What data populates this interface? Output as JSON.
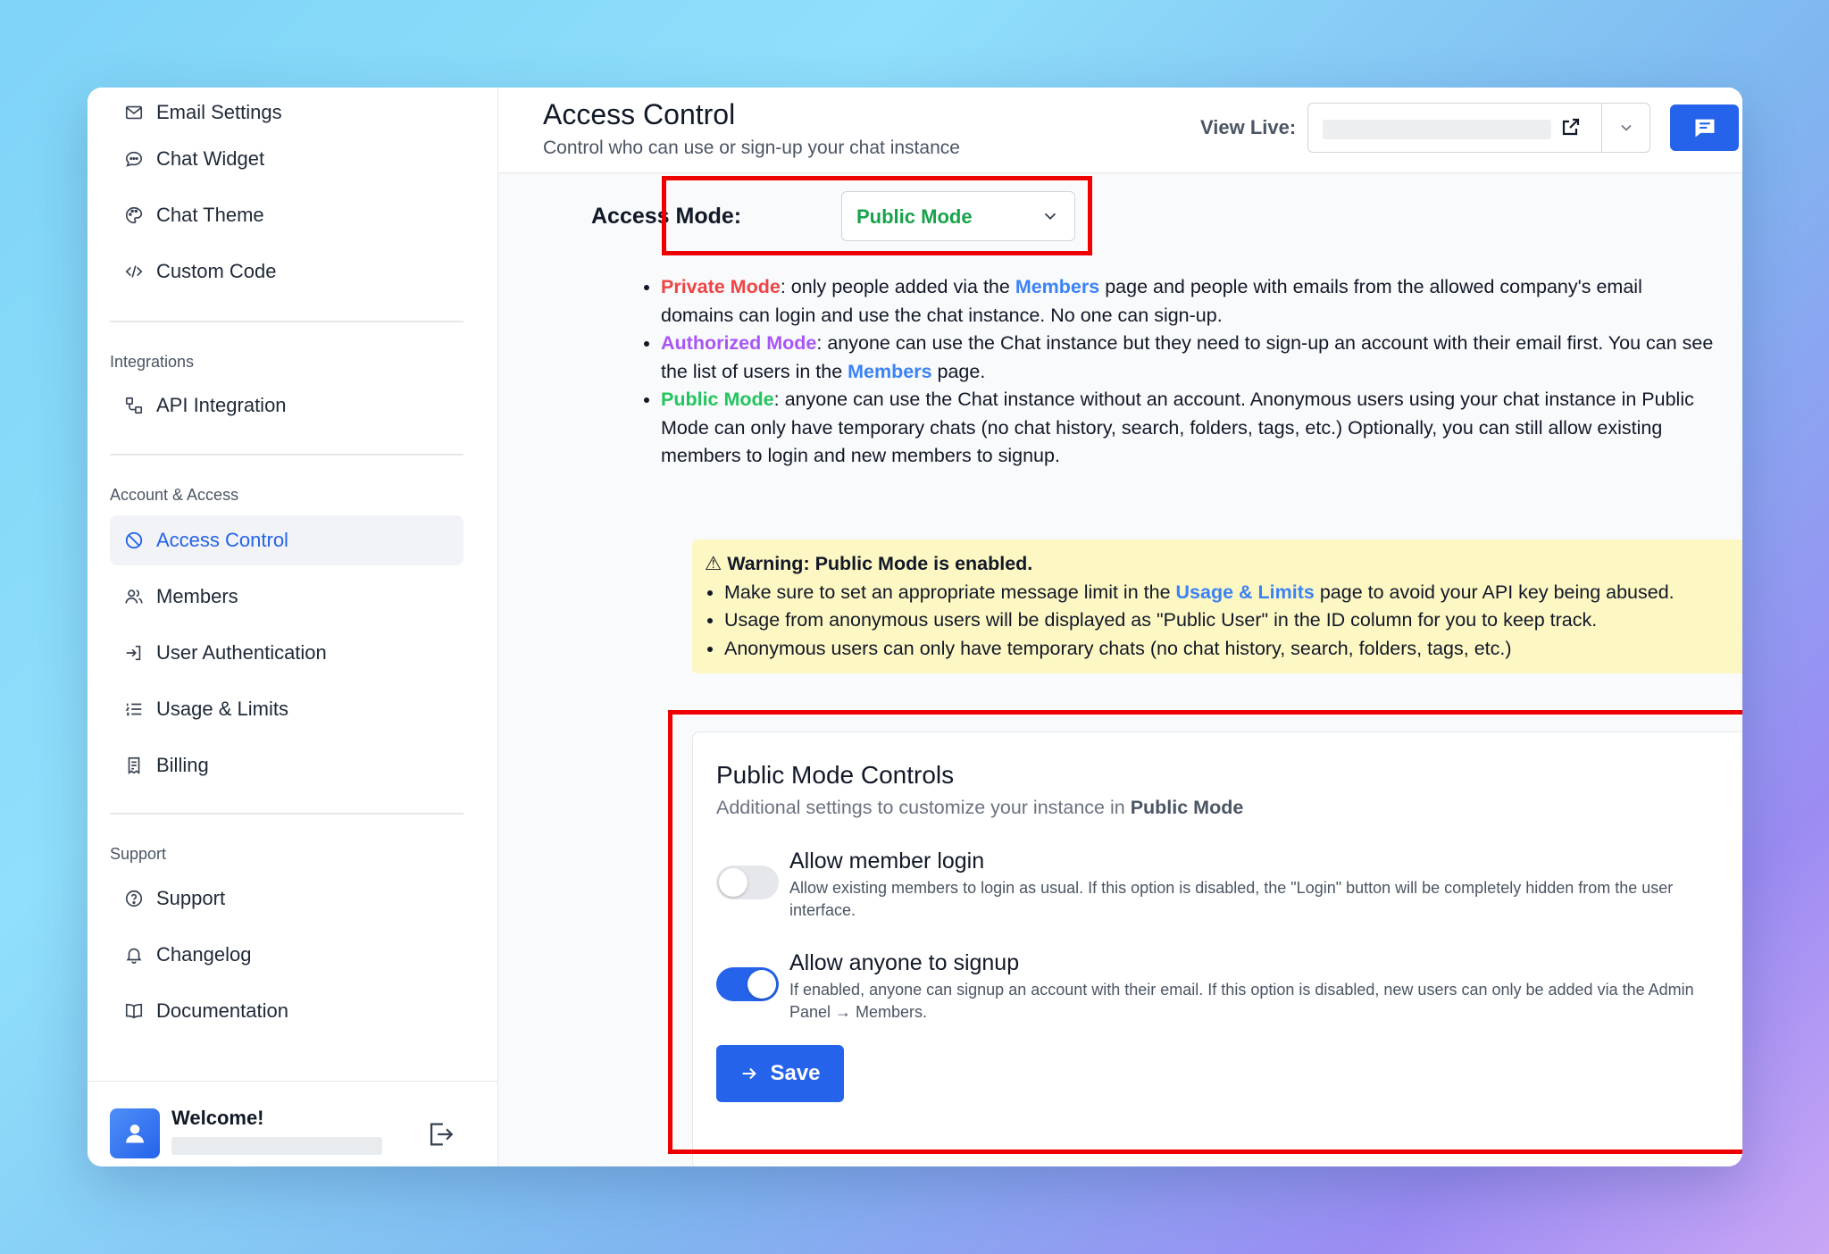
{
  "sidebar": {
    "top_items": [
      {
        "label": "Email Settings",
        "icon": "mail-icon"
      },
      {
        "label": "Chat Widget",
        "icon": "chat-bubble-icon"
      },
      {
        "label": "Chat Theme",
        "icon": "palette-icon"
      },
      {
        "label": "Custom Code",
        "icon": "code-icon"
      }
    ],
    "integrations": {
      "label": "Integrations",
      "items": [
        {
          "label": "API Integration",
          "icon": "api-icon"
        }
      ]
    },
    "account": {
      "label": "Account & Access",
      "items": [
        {
          "label": "Access Control",
          "icon": "ban-icon",
          "active": true
        },
        {
          "label": "Members",
          "icon": "users-icon"
        },
        {
          "label": "User Authentication",
          "icon": "login-icon"
        },
        {
          "label": "Usage & Limits",
          "icon": "list-icon"
        },
        {
          "label": "Billing",
          "icon": "receipt-icon"
        }
      ]
    },
    "support": {
      "label": "Support",
      "items": [
        {
          "label": "Support",
          "icon": "help-circle-icon"
        },
        {
          "label": "Changelog",
          "icon": "bell-icon"
        },
        {
          "label": "Documentation",
          "icon": "book-icon"
        }
      ]
    },
    "footer": {
      "welcome": "Welcome!"
    }
  },
  "header": {
    "title": "Access Control",
    "subtitle": "Control who can use or sign-up your chat instance",
    "view_live_label": "View Live:"
  },
  "access_mode": {
    "label": "Access Mode:",
    "selected": "Public Mode"
  },
  "modes": {
    "private": {
      "name": "Private Mode",
      "text1": ": only people added via the ",
      "link": "Members",
      "text2": " page and people with emails from the allowed company's email domains can login and use the chat instance. No one can sign-up."
    },
    "authorized": {
      "name": "Authorized Mode",
      "text1": ": anyone can use the Chat instance but they need to sign-up an account with their email first. You can see the list of users in the ",
      "link": "Members",
      "text2": " page."
    },
    "public": {
      "name": "Public Mode",
      "text1": ": anyone can use the Chat instance without an account. Anonymous users using your chat instance in Public Mode can only have temporary chats (no chat history, search, folders, tags, etc.) Optionally, you can still allow existing members to login and new members to signup."
    }
  },
  "warning": {
    "title": "⚠ Warning: Public Mode is enabled.",
    "b1_pre": "Make sure to set an appropriate message limit in the ",
    "b1_link": "Usage & Limits",
    "b1_post": " page to avoid your API key being abused.",
    "b2": "Usage from anonymous users will be displayed as \"Public User\" in the ID column for you to keep track.",
    "b3": "Anonymous users can only have temporary chats (no chat history, search, folders, tags, etc.)"
  },
  "controls": {
    "title": "Public Mode Controls",
    "subtitle_pre": "Additional settings to customize your instance in ",
    "subtitle_bold": "Public Mode",
    "member_login": {
      "title": "Allow member login",
      "desc": "Allow existing members to login as usual. If this option is disabled, the \"Login\" button will be completely hidden from the user interface.",
      "enabled": false
    },
    "signup": {
      "title": "Allow anyone to signup",
      "desc": "If enabled, anyone can signup an account with their email. If this option is disabled, new users can only be added via the Admin Panel → Members.",
      "enabled": true
    },
    "save_label": "Save"
  },
  "colors": {
    "accent": "#2563eb",
    "private": "#ef4444",
    "authorized": "#a855f7",
    "public": "#22c55e",
    "highlight": "#ee0000",
    "warning_bg": "#fdf7c3"
  }
}
